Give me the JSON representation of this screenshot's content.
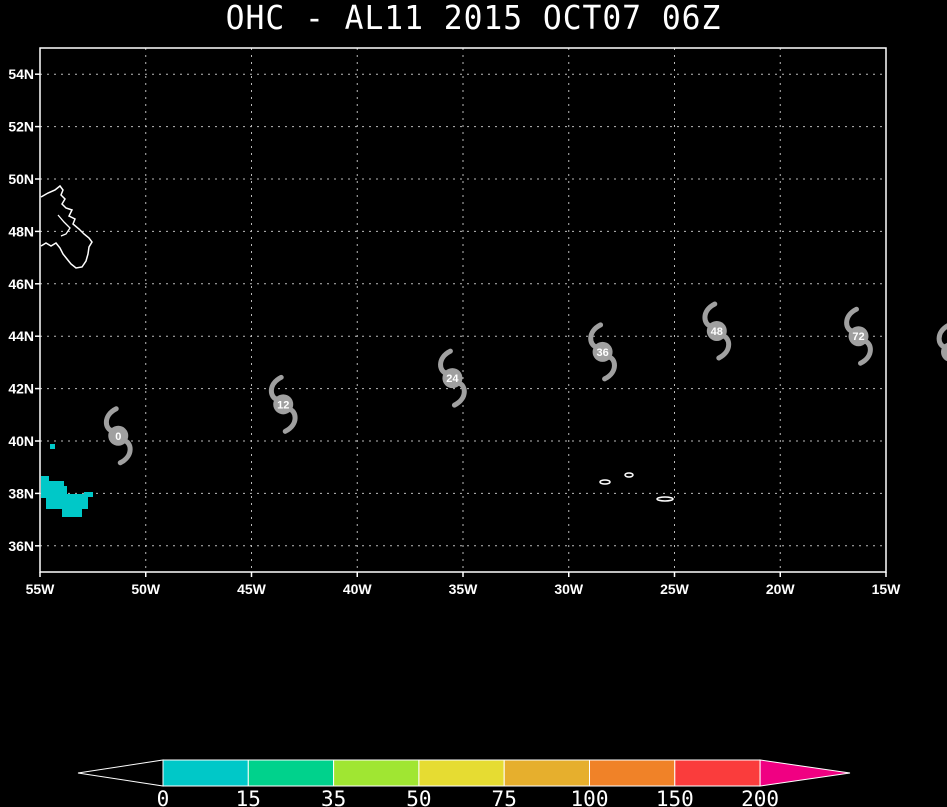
{
  "title": "OHC - AL11 2015 OCT07 06Z",
  "map": {
    "lon_range": [
      -55,
      -15
    ],
    "lat_range": [
      35,
      55
    ],
    "grid": true,
    "x_ticks": [
      {
        "lon": -55,
        "label": "55W"
      },
      {
        "lon": -50,
        "label": "50W"
      },
      {
        "lon": -45,
        "label": "45W"
      },
      {
        "lon": -40,
        "label": "40W"
      },
      {
        "lon": -35,
        "label": "35W"
      },
      {
        "lon": -30,
        "label": "30W"
      },
      {
        "lon": -25,
        "label": "25W"
      },
      {
        "lon": -20,
        "label": "20W"
      },
      {
        "lon": -15,
        "label": "15W"
      }
    ],
    "y_ticks": [
      {
        "lat": 54,
        "label": "54N"
      },
      {
        "lat": 52,
        "label": "52N"
      },
      {
        "lat": 50,
        "label": "50N"
      },
      {
        "lat": 48,
        "label": "48N"
      },
      {
        "lat": 46,
        "label": "46N"
      },
      {
        "lat": 44,
        "label": "44N"
      },
      {
        "lat": 42,
        "label": "42N"
      },
      {
        "lat": 40,
        "label": "40N"
      },
      {
        "lat": 38,
        "label": "38N"
      },
      {
        "lat": 36,
        "label": "36N"
      }
    ],
    "track": [
      {
        "hour": "0",
        "lon": -51.3,
        "lat": 40.2
      },
      {
        "hour": "12",
        "lon": -43.5,
        "lat": 41.4
      },
      {
        "hour": "24",
        "lon": -35.5,
        "lat": 42.4
      },
      {
        "hour": "36",
        "lon": -28.4,
        "lat": 43.4
      },
      {
        "hour": "48",
        "lon": -23.0,
        "lat": 44.2
      },
      {
        "hour": "72",
        "lon": -16.3,
        "lat": 44.0
      }
    ],
    "storm_color": "#a0a0a0",
    "coast_color": "#ffffff",
    "ohc_color": "#00c8c8"
  },
  "colorbar": {
    "labels": [
      "0",
      "15",
      "35",
      "50",
      "75",
      "100",
      "150",
      "200"
    ],
    "colors": [
      "#00c8c8",
      "#00d28c",
      "#a0e632",
      "#e6dc32",
      "#e6af2d",
      "#f08228",
      "#fa3c3c",
      "#f00082"
    ],
    "low_color": "#000000",
    "high_color": "#f00082"
  }
}
